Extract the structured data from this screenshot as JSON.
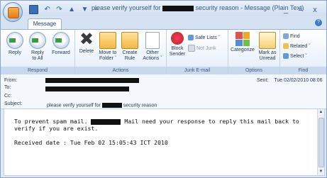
{
  "window": {
    "title_prefix": "please verify yourself for",
    "title_suffix": "security reason - Message (Plain Text)",
    "controls": [
      "_",
      "=",
      "x"
    ]
  },
  "quick_access": {
    "icons": [
      "save-icon",
      "undo-icon",
      "redo-icon",
      "up-icon",
      "down-icon"
    ],
    "more": "="
  },
  "tabs": [
    {
      "label": "Message",
      "selected": true
    }
  ],
  "ribbon": {
    "respond": {
      "label": "Respond",
      "buttons": [
        {
          "label_line1": "Reply",
          "label_line2": ""
        },
        {
          "label_line1": "Reply",
          "label_line2": "to All"
        },
        {
          "label_line1": "Forward",
          "label_line2": ""
        }
      ]
    },
    "actions": {
      "label": "Actions",
      "buttons": [
        {
          "label_line1": "Delete",
          "label_line2": ""
        },
        {
          "label_line1": "Move to",
          "label_line2": "Folder ˇ"
        },
        {
          "label_line1": "Create",
          "label_line2": "Rule"
        },
        {
          "label_line1": "Other",
          "label_line2": "Actions ˇ"
        }
      ]
    },
    "junk": {
      "label": "Junk E-mail",
      "block_line1": "Block",
      "block_line2": "Sender",
      "safe_lists": "Safe Lists ˇ",
      "not_junk": "Not Junk"
    },
    "options": {
      "label": "Options",
      "categorize": "Categorize",
      "mark_line1": "Mark as",
      "mark_line2": "Unread"
    },
    "find": {
      "label": "Find",
      "find": "Find",
      "related": "Related ˇ",
      "select": "Select ˇ"
    }
  },
  "headers": {
    "from_label": "From:",
    "to_label": "To:",
    "cc_label": "Cc:",
    "subject_label": "Subject:",
    "subject_prefix": "please verify yourself for",
    "subject_suffix": "security reason",
    "sent_label": "Sent:",
    "sent_value": "Tue 02/02/2010 08:06"
  },
  "body": {
    "line1_start": "To prevent spam mail.",
    "line1_end": "Mail need your response to reply this mail back to",
    "line2": "verify if you are exist.",
    "line4": "Received date : Tue Feb 02 15:05:43 ICT 2010"
  },
  "colors": {
    "accent": "#3c78c8",
    "ribbon_label": "#c8d9ee",
    "redaction": "#111111"
  }
}
